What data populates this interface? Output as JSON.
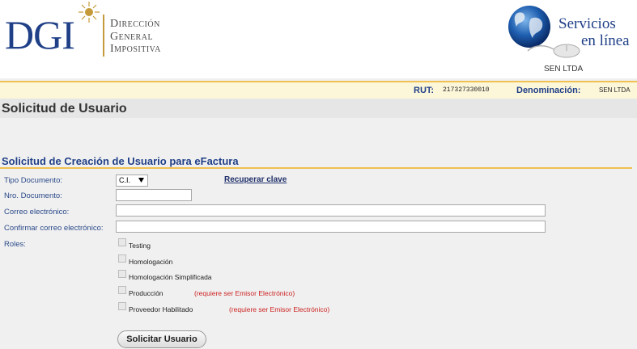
{
  "header": {
    "logo": {
      "mark": "DGI",
      "lines": [
        "Dirección",
        "General",
        "Impositiva"
      ]
    },
    "services": {
      "line1": "Servicios",
      "line2": "en línea",
      "user": "SEN LTDA"
    }
  },
  "info_bar": {
    "rut_label": "RUT:",
    "rut_value": "217327330010",
    "denominacion_label": "Denominación:",
    "denominacion_value": "SEN LTDA"
  },
  "page": {
    "title": "Solicitud de Usuario",
    "section_title": "Solicitud de Creación de Usuario para eFactura"
  },
  "form": {
    "tipo_documento_label": "Tipo Documento:",
    "tipo_documento_value": "C.I.",
    "recuperar_clave": "Recuperar clave",
    "nro_documento_label": "Nro. Documento:",
    "correo_label": "Correo electrónico:",
    "confirmar_correo_label": "Confirmar correo electrónico:",
    "roles_label": "Roles:",
    "roles": [
      {
        "label": "Testing",
        "note": ""
      },
      {
        "label": "Homologación",
        "note": ""
      },
      {
        "label": "Homologación Simplificada",
        "note": ""
      },
      {
        "label": "Producción",
        "note": "(requiere ser Emisor Electrónico)"
      },
      {
        "label": "Proveedor Habilitado",
        "note": "(requiere ser Emisor Electrónico)"
      }
    ],
    "submit_label": "Solicitar Usuario"
  },
  "colors": {
    "brand_blue": "#1f3f87",
    "gold": "#f0c050",
    "warning_red": "#cc2222"
  }
}
